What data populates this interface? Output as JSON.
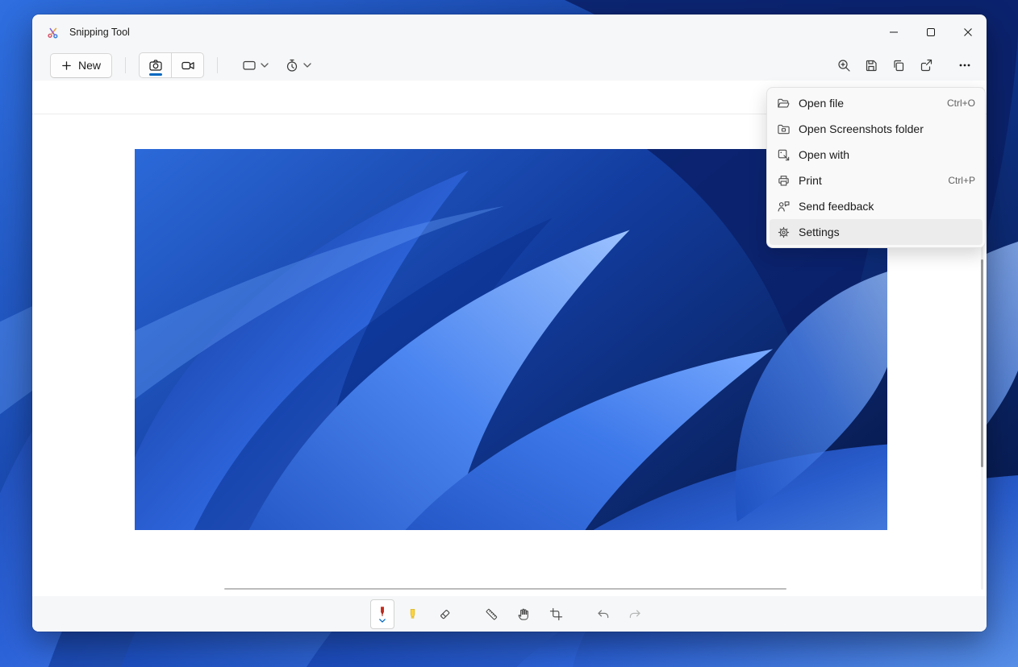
{
  "window": {
    "title": "Snipping Tool"
  },
  "toolbar": {
    "new_button": {
      "label": "New",
      "icon": "plus-icon"
    },
    "mode_toggle": {
      "options": [
        {
          "name": "snip-mode",
          "icon": "camera-icon",
          "selected": true
        },
        {
          "name": "record-mode",
          "icon": "video-camera-icon",
          "selected": false
        }
      ]
    },
    "snip_shape_dropdown": {
      "icon": "rectangle-icon",
      "chevron": "chevron-down-icon"
    },
    "delay_dropdown": {
      "icon": "timer-icon",
      "chevron": "chevron-down-icon"
    },
    "actions": [
      {
        "name": "zoom",
        "icon": "magnifier-plus-icon"
      },
      {
        "name": "save",
        "icon": "save-icon"
      },
      {
        "name": "copy",
        "icon": "copy-icon"
      },
      {
        "name": "share",
        "icon": "share-icon"
      },
      {
        "name": "more-options",
        "icon": "ellipsis-icon"
      }
    ]
  },
  "menu": {
    "items": [
      {
        "label": "Open file",
        "shortcut": "Ctrl+O",
        "icon": "open-file-icon",
        "hover": false
      },
      {
        "label": "Open Screenshots folder",
        "shortcut": "",
        "icon": "screenshots-folder-icon",
        "hover": false
      },
      {
        "label": "Open with",
        "shortcut": "",
        "icon": "open-with-icon",
        "hover": false
      },
      {
        "label": "Print",
        "shortcut": "Ctrl+P",
        "icon": "printer-icon",
        "hover": false
      },
      {
        "label": "Send feedback",
        "shortcut": "",
        "icon": "feedback-icon",
        "hover": false
      },
      {
        "label": "Settings",
        "shortcut": "",
        "icon": "gear-icon",
        "hover": true
      }
    ]
  },
  "bottom_toolbar": {
    "tools": [
      {
        "name": "ballpoint-pen",
        "selected": true,
        "color": "#c42b1c"
      },
      {
        "name": "highlighter",
        "selected": false,
        "color": "#ffd43d"
      },
      {
        "name": "eraser",
        "selected": false
      },
      {
        "name": "ruler",
        "selected": false
      },
      {
        "name": "touch-writing",
        "selected": false
      },
      {
        "name": "crop",
        "selected": false
      },
      {
        "name": "undo",
        "enabled": true
      },
      {
        "name": "redo",
        "enabled": false
      }
    ]
  },
  "content": {
    "snip_image": "blue-bloom-wallpaper-screenshot",
    "desktop_wallpaper": "blue-bloom-wallpaper"
  },
  "colors": {
    "accent": "#0067c0",
    "window_bg": "#f6f7f8",
    "canvas_bg": "#ffffff",
    "menu_bg": "#f9f9f9",
    "menu_hover": "#ececec",
    "pen_red": "#c42b1c",
    "highlighter_yellow": "#ffd43d"
  }
}
